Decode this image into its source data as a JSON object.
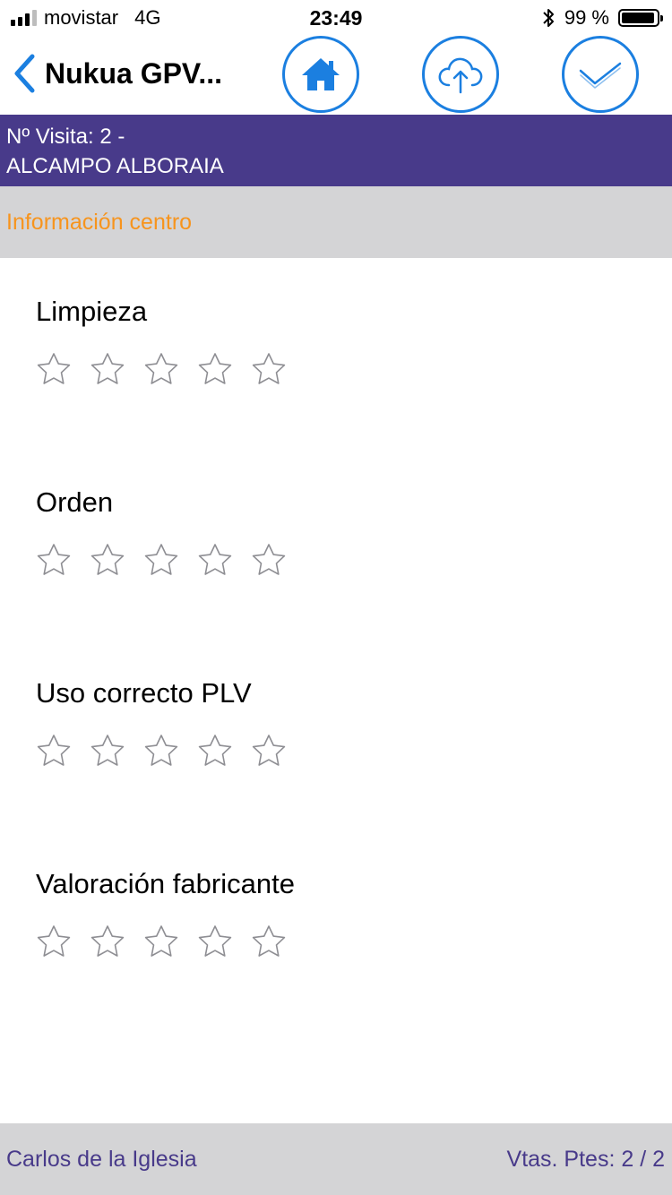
{
  "status_bar": {
    "carrier": "movistar",
    "network": "4G",
    "time": "23:49",
    "battery_text": "99 %",
    "battery_level": 0.99,
    "signal_bars_on": 3,
    "signal_bars_total": 4
  },
  "nav": {
    "title": "Nukua GPV...",
    "icons": [
      "chevron-left-icon",
      "home-icon",
      "cloud-upload-icon",
      "checkmark-icon"
    ]
  },
  "visit": {
    "line1": "Nº Visita: 2 -",
    "line2": "ALCAMPO ALBORAIA"
  },
  "section": {
    "title": "Información centro"
  },
  "ratings": [
    {
      "label": "Limpieza",
      "value": 0,
      "max": 5
    },
    {
      "label": "Orden",
      "value": 0,
      "max": 5
    },
    {
      "label": "Uso correcto PLV",
      "value": 0,
      "max": 5
    },
    {
      "label": "Valoración fabricante",
      "value": 0,
      "max": 5
    }
  ],
  "footer": {
    "user": "Carlos de la Iglesia",
    "pending": "Vtas. Ptes: 2 / 2"
  },
  "colors": {
    "accent": "#1b7fe0",
    "header_bg": "#483a8a",
    "section_text": "#f7941d",
    "band_bg": "#d4d4d6",
    "star_outline": "#8e8e93"
  }
}
